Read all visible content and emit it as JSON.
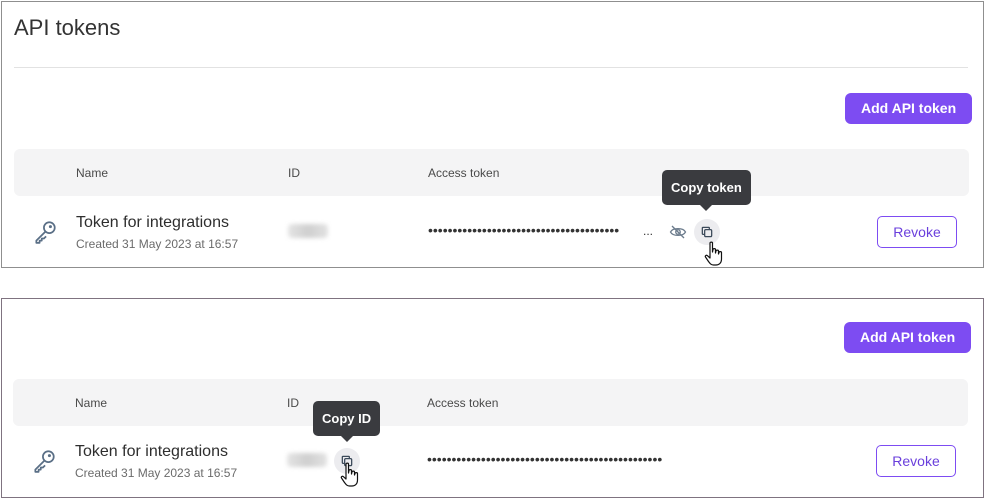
{
  "page": {
    "title": "API tokens"
  },
  "actions": {
    "add_label": "Add API token"
  },
  "table": {
    "columns": [
      "Name",
      "ID",
      "Access token"
    ]
  },
  "token": {
    "name": "Token for integrations",
    "created": "Created 31 May 2023 at 16:57",
    "masked_value": "••••••••••••••••••••••••••••••••••••••••••••••••",
    "masked_value_hidden": "•••••••••••••••••••••••••••••••••••••••",
    "truncation": "...",
    "revoke_label": "Revoke"
  },
  "tooltips": {
    "copy_token": "Copy token",
    "copy_id": "Copy ID"
  },
  "colors": {
    "accent": "#7d4cf2",
    "tooltip_bg": "#3a3b3f",
    "header_bg": "#f4f4f5"
  },
  "icons": {
    "key": "key-icon",
    "hide": "eye-slash-icon",
    "copy": "copy-icon",
    "cursor": "hand-pointer-icon"
  }
}
